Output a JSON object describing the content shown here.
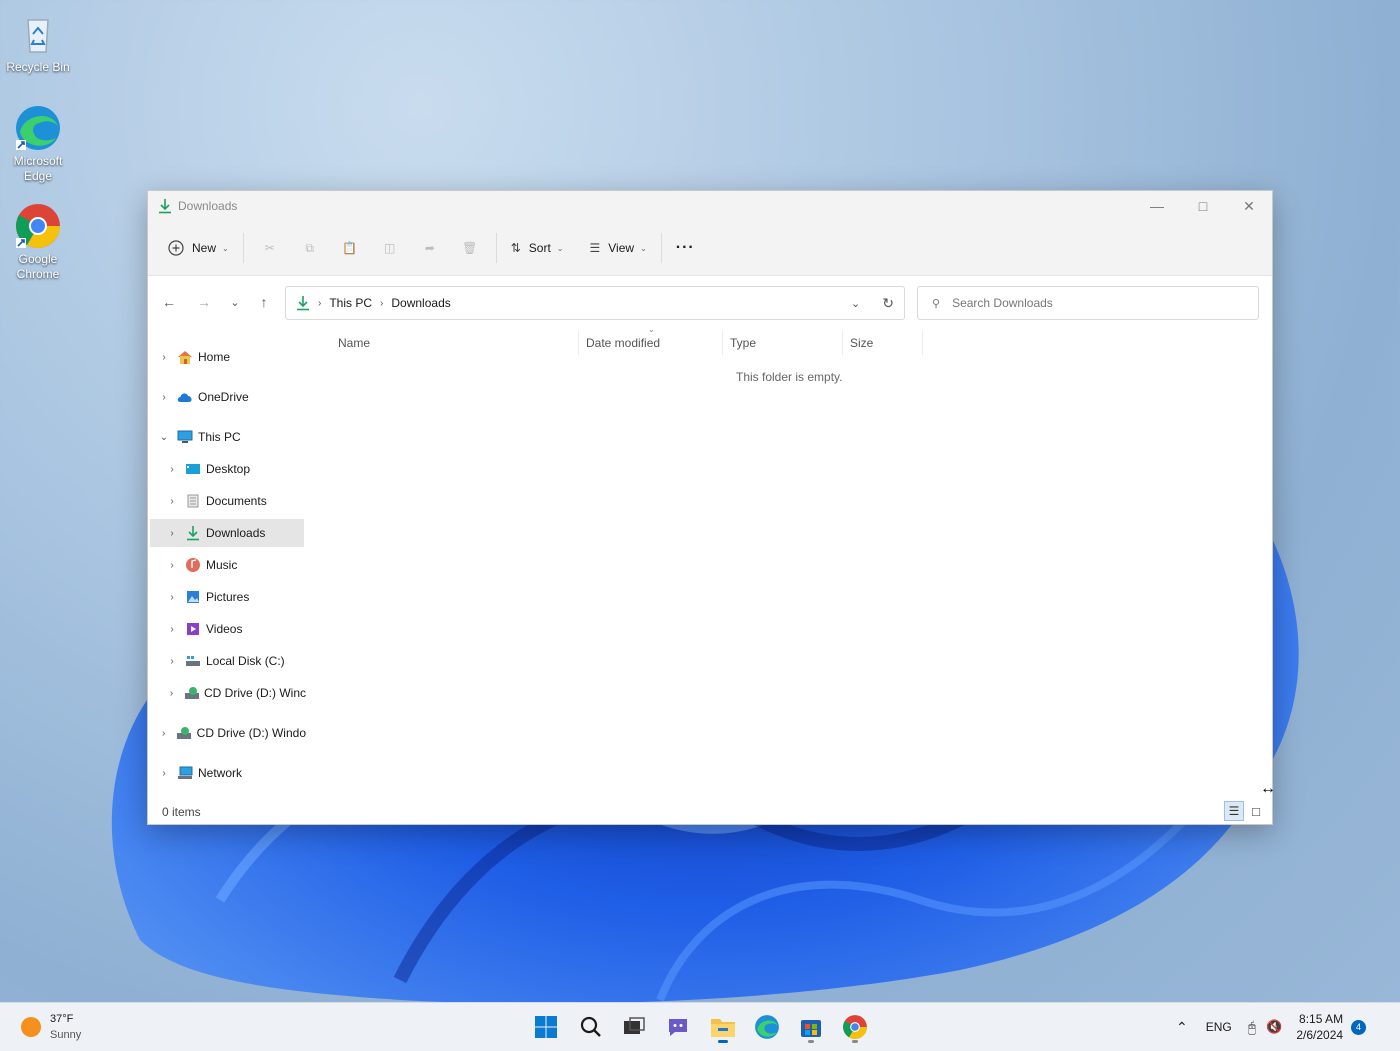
{
  "desktop": {
    "icons": [
      {
        "label": "Recycle Bin"
      },
      {
        "label": "Microsoft Edge"
      },
      {
        "label": "Google Chrome"
      }
    ]
  },
  "window": {
    "title": "Downloads",
    "toolbar": {
      "new_label": "New",
      "sort_label": "Sort",
      "view_label": "View",
      "more_label": "···"
    },
    "address": {
      "crumbs": [
        "This PC",
        "Downloads"
      ],
      "search_placeholder": "Search Downloads"
    },
    "nav": {
      "items": [
        {
          "label": "Home"
        },
        {
          "label": "OneDrive"
        },
        {
          "label": "This PC"
        },
        {
          "label": "Desktop"
        },
        {
          "label": "Documents"
        },
        {
          "label": "Downloads"
        },
        {
          "label": "Music"
        },
        {
          "label": "Pictures"
        },
        {
          "label": "Videos"
        },
        {
          "label": "Local Disk (C:)"
        },
        {
          "label": "CD Drive (D:) Winc"
        },
        {
          "label": "CD Drive (D:) Windo"
        },
        {
          "label": "Network"
        }
      ]
    },
    "columns": [
      "Name",
      "Date modified",
      "Type",
      "Size"
    ],
    "empty_message": "This folder is empty.",
    "status": "0 items"
  },
  "taskbar": {
    "weather_temp": "37°F",
    "weather_desc": "Sunny",
    "language": "ENG",
    "time": "8:15 AM",
    "date": "2/6/2024",
    "notification_count": "4"
  },
  "colors": {
    "accent": "#0067c0",
    "download_green": "#1aa260",
    "folder_yellow": "#f2c14e"
  }
}
